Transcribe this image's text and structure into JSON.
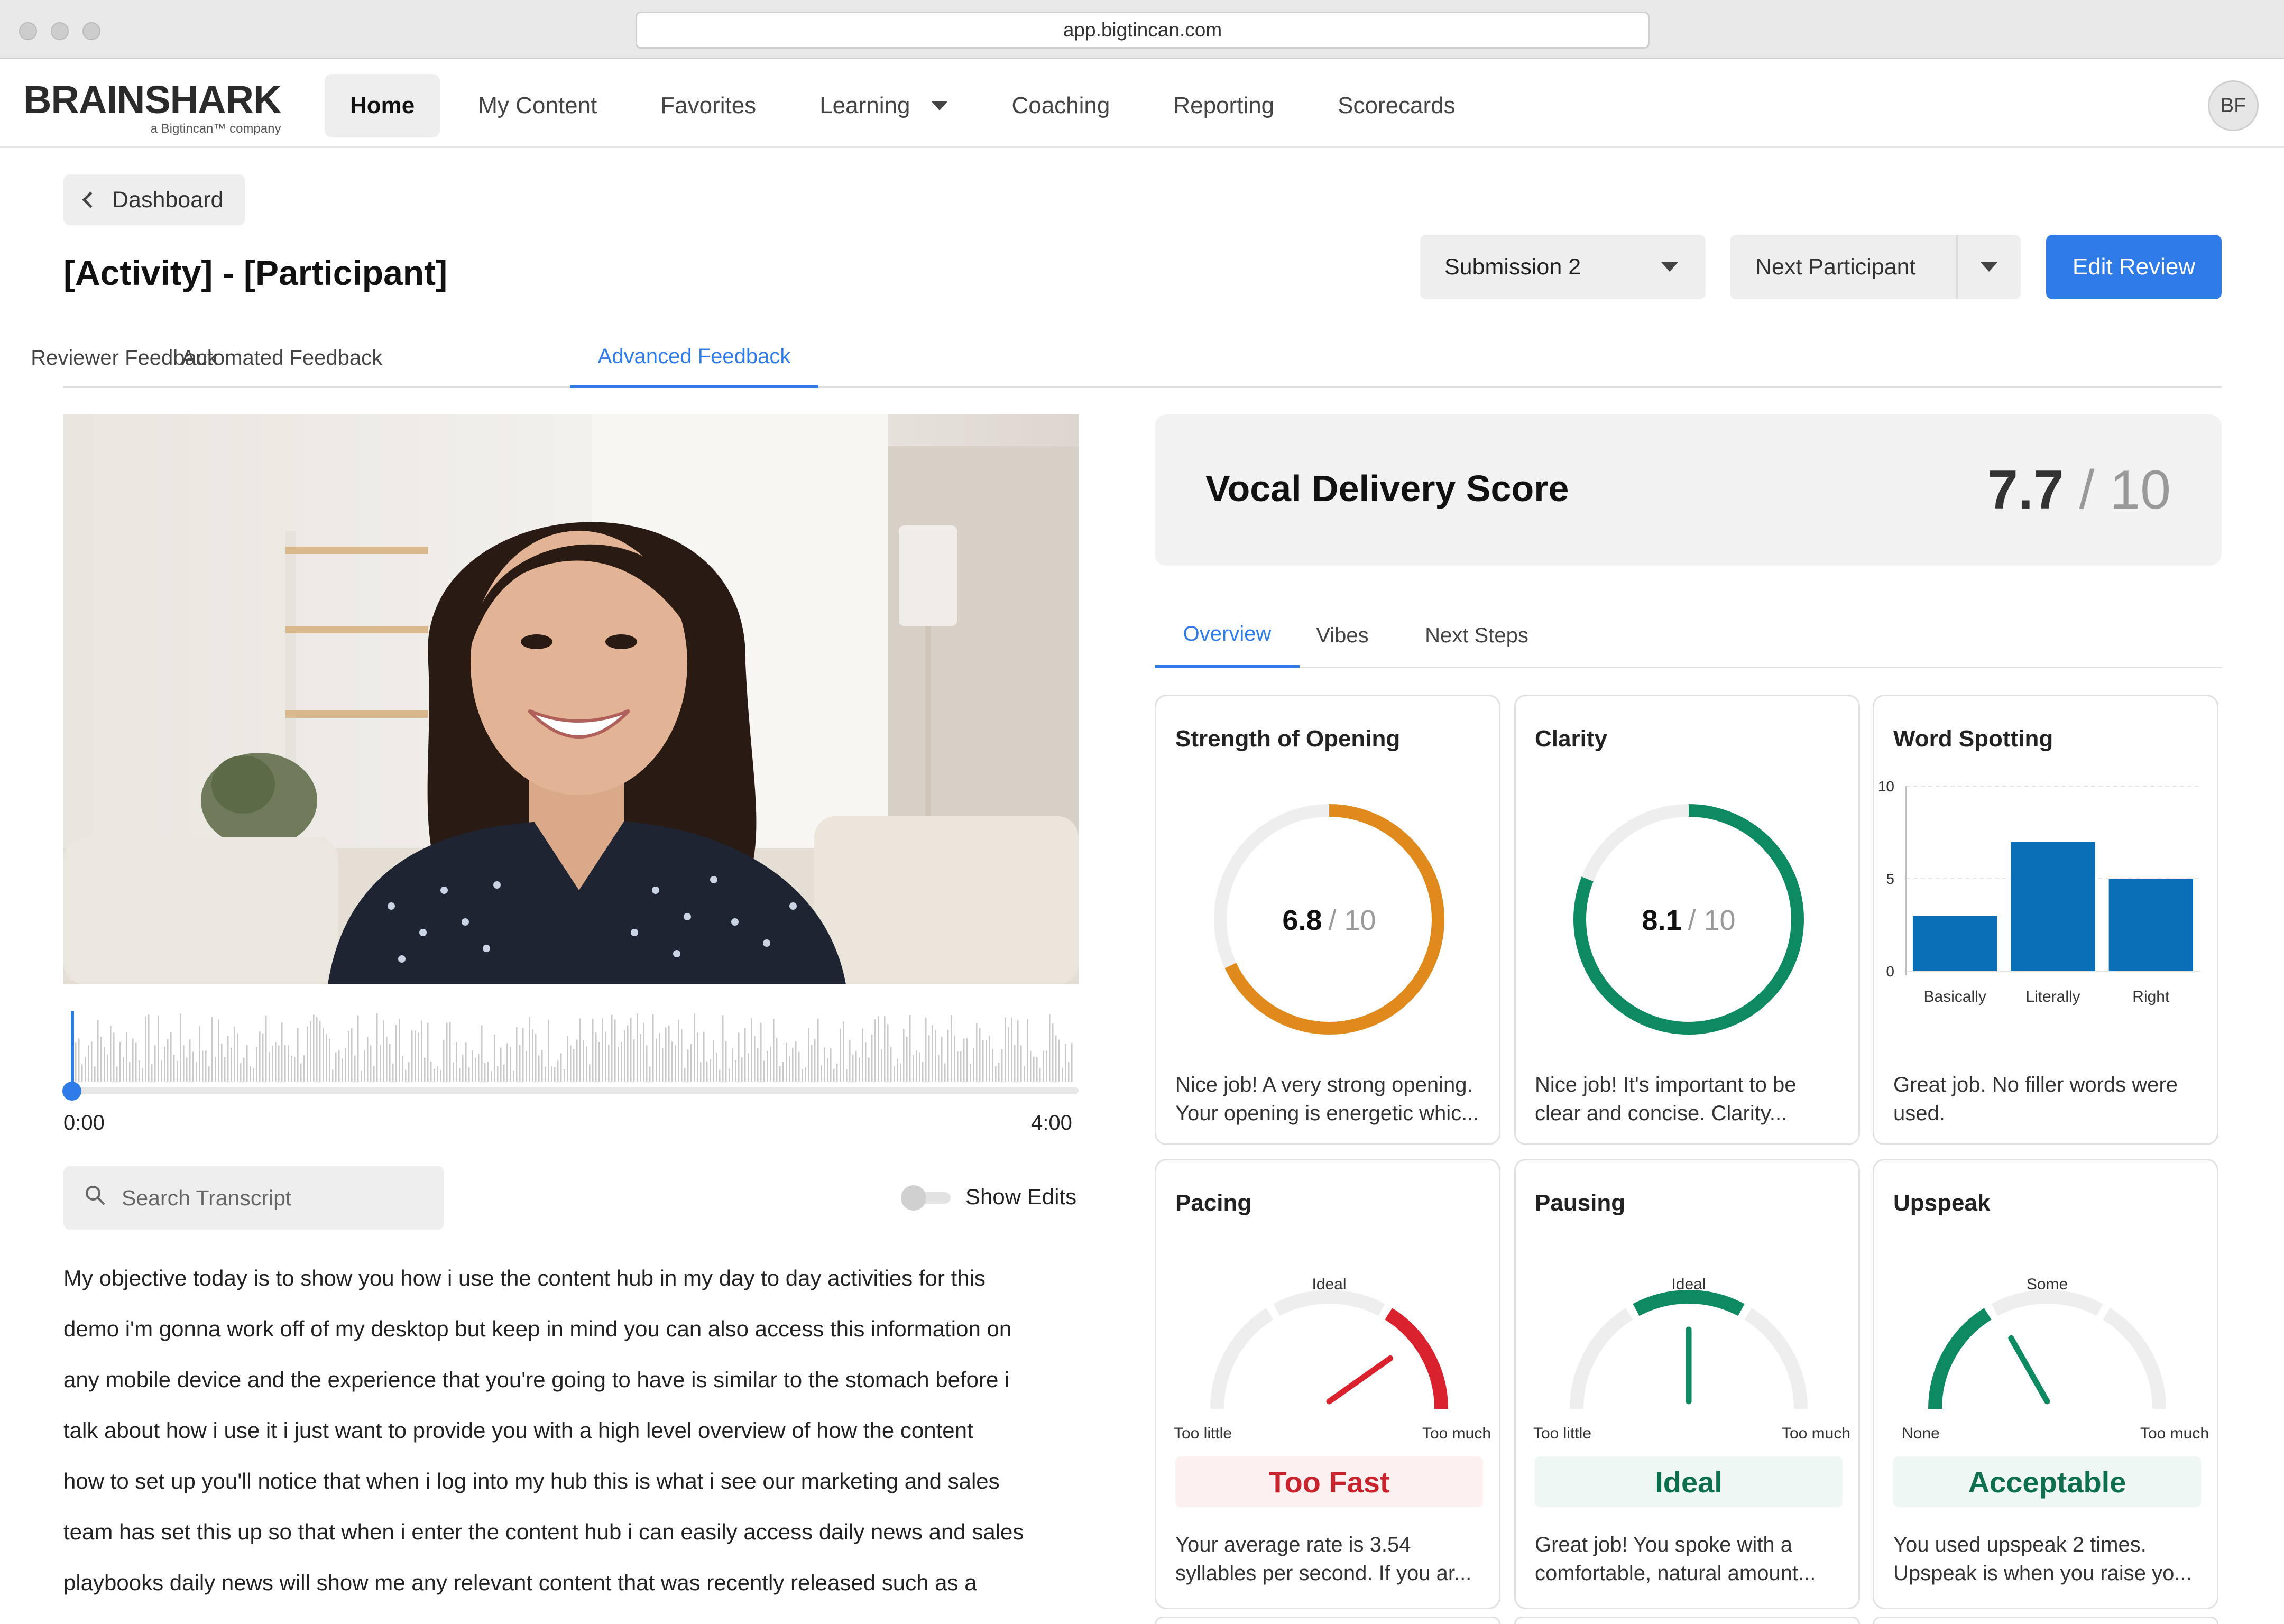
{
  "browser": {
    "url": "app.bigtincan.com"
  },
  "brand": {
    "name": "BRAINSHARK",
    "tagline": "a Bigtincan™ company"
  },
  "nav": {
    "items": [
      {
        "label": "Home",
        "active": true
      },
      {
        "label": "My Content"
      },
      {
        "label": "Favorites"
      },
      {
        "label": "Learning",
        "has_dropdown": true
      },
      {
        "label": "Coaching"
      },
      {
        "label": "Reporting"
      },
      {
        "label": "Scorecards"
      }
    ],
    "avatar_initials": "BF"
  },
  "page": {
    "back_label": "Dashboard",
    "title": "[Activity] - [Participant]",
    "submission_select": "Submission 2",
    "next_participant": "Next Participant",
    "edit_review": "Edit Review",
    "tabs": [
      "Reviewer Feedback",
      "Automated Feedback",
      "Advanced Feedback"
    ],
    "active_tab": "Advanced Feedback"
  },
  "player": {
    "time_start": "0:00",
    "time_end": "4:00",
    "progress": 0.0,
    "search_placeholder": "Search Transcript",
    "show_edits_label": "Show Edits",
    "show_edits_on": false
  },
  "transcript": {
    "lines": [
      "My objective today is to show you how i use the content hub in my day to day activities for this",
      "demo i'm gonna work off of my desktop but keep in mind you can also access this information on",
      "any mobile device and the experience that you're going to have is similar to the stomach before i",
      "talk about how i use it i just want to provide you with a high level overview of how the content",
      "how to set up you'll notice that when i log into my hub this is what i see our marketing and sales",
      "team has set this up so that when i enter the content hub i can easily access daily news and sales",
      "playbooks daily news will show me any relevant content that was recently released such as a"
    ]
  },
  "score": {
    "title": "Vocal Delivery Score",
    "value": "7.7",
    "max": "/ 10"
  },
  "subtabs": [
    "Overview",
    "Vibes",
    "Next Steps"
  ],
  "active_subtab": "Overview",
  "cards": {
    "opening": {
      "title": "Strength of Opening",
      "score": "6.8",
      "max": "/ 10",
      "fraction": 0.68,
      "color": "#e08a1e",
      "desc": [
        "Nice job! A very strong opening.",
        "Your opening is energetic whic..."
      ]
    },
    "clarity": {
      "title": "Clarity",
      "score": "8.1",
      "max": "/ 10",
      "fraction": 0.81,
      "color": "#0e8a62",
      "desc": [
        "Nice job! It's important to be",
        "clear and concise. Clarity..."
      ]
    },
    "word_spotting": {
      "title": "Word Spotting",
      "desc": [
        "Great job. No filler words were",
        "used."
      ]
    },
    "pacing": {
      "title": "Pacing",
      "label_top": "Ideal",
      "label_left": "Too little",
      "label_right": "Too much",
      "needle": 0.78,
      "highlight": "high",
      "status": "Too Fast",
      "status_color": "#c8242e",
      "status_bg": "#fdf0f1",
      "desc": [
        "Your average rate is 3.54",
        "syllables per second. If you ar..."
      ]
    },
    "pausing": {
      "title": "Pausing",
      "label_top": "Ideal",
      "label_left": "Too little",
      "label_right": "Too much",
      "needle": 0.5,
      "highlight": "mid",
      "status": "Ideal",
      "status_color": "#0e6e4e",
      "status_bg": "#eef7f3",
      "desc": [
        "Great job! You spoke with a",
        "comfortable, natural amount..."
      ]
    },
    "upspeak": {
      "title": "Upspeak",
      "label_top": "Some",
      "label_left": "None",
      "label_right": "Too much",
      "needle": 0.35,
      "highlight": "low",
      "status": "Acceptable",
      "status_color": "#0e6e4e",
      "status_bg": "#eef7f3",
      "desc": [
        "You used upspeak 2 times.",
        "Upspeak is when you raise yo..."
      ]
    }
  },
  "chart_data": {
    "type": "bar",
    "categories": [
      "Basically",
      "Literally",
      "Right"
    ],
    "values": [
      3,
      7,
      5
    ],
    "ylim": [
      0,
      10
    ],
    "yticks": [
      0,
      5,
      10
    ],
    "color": "#0b6fb8",
    "grid": true
  }
}
